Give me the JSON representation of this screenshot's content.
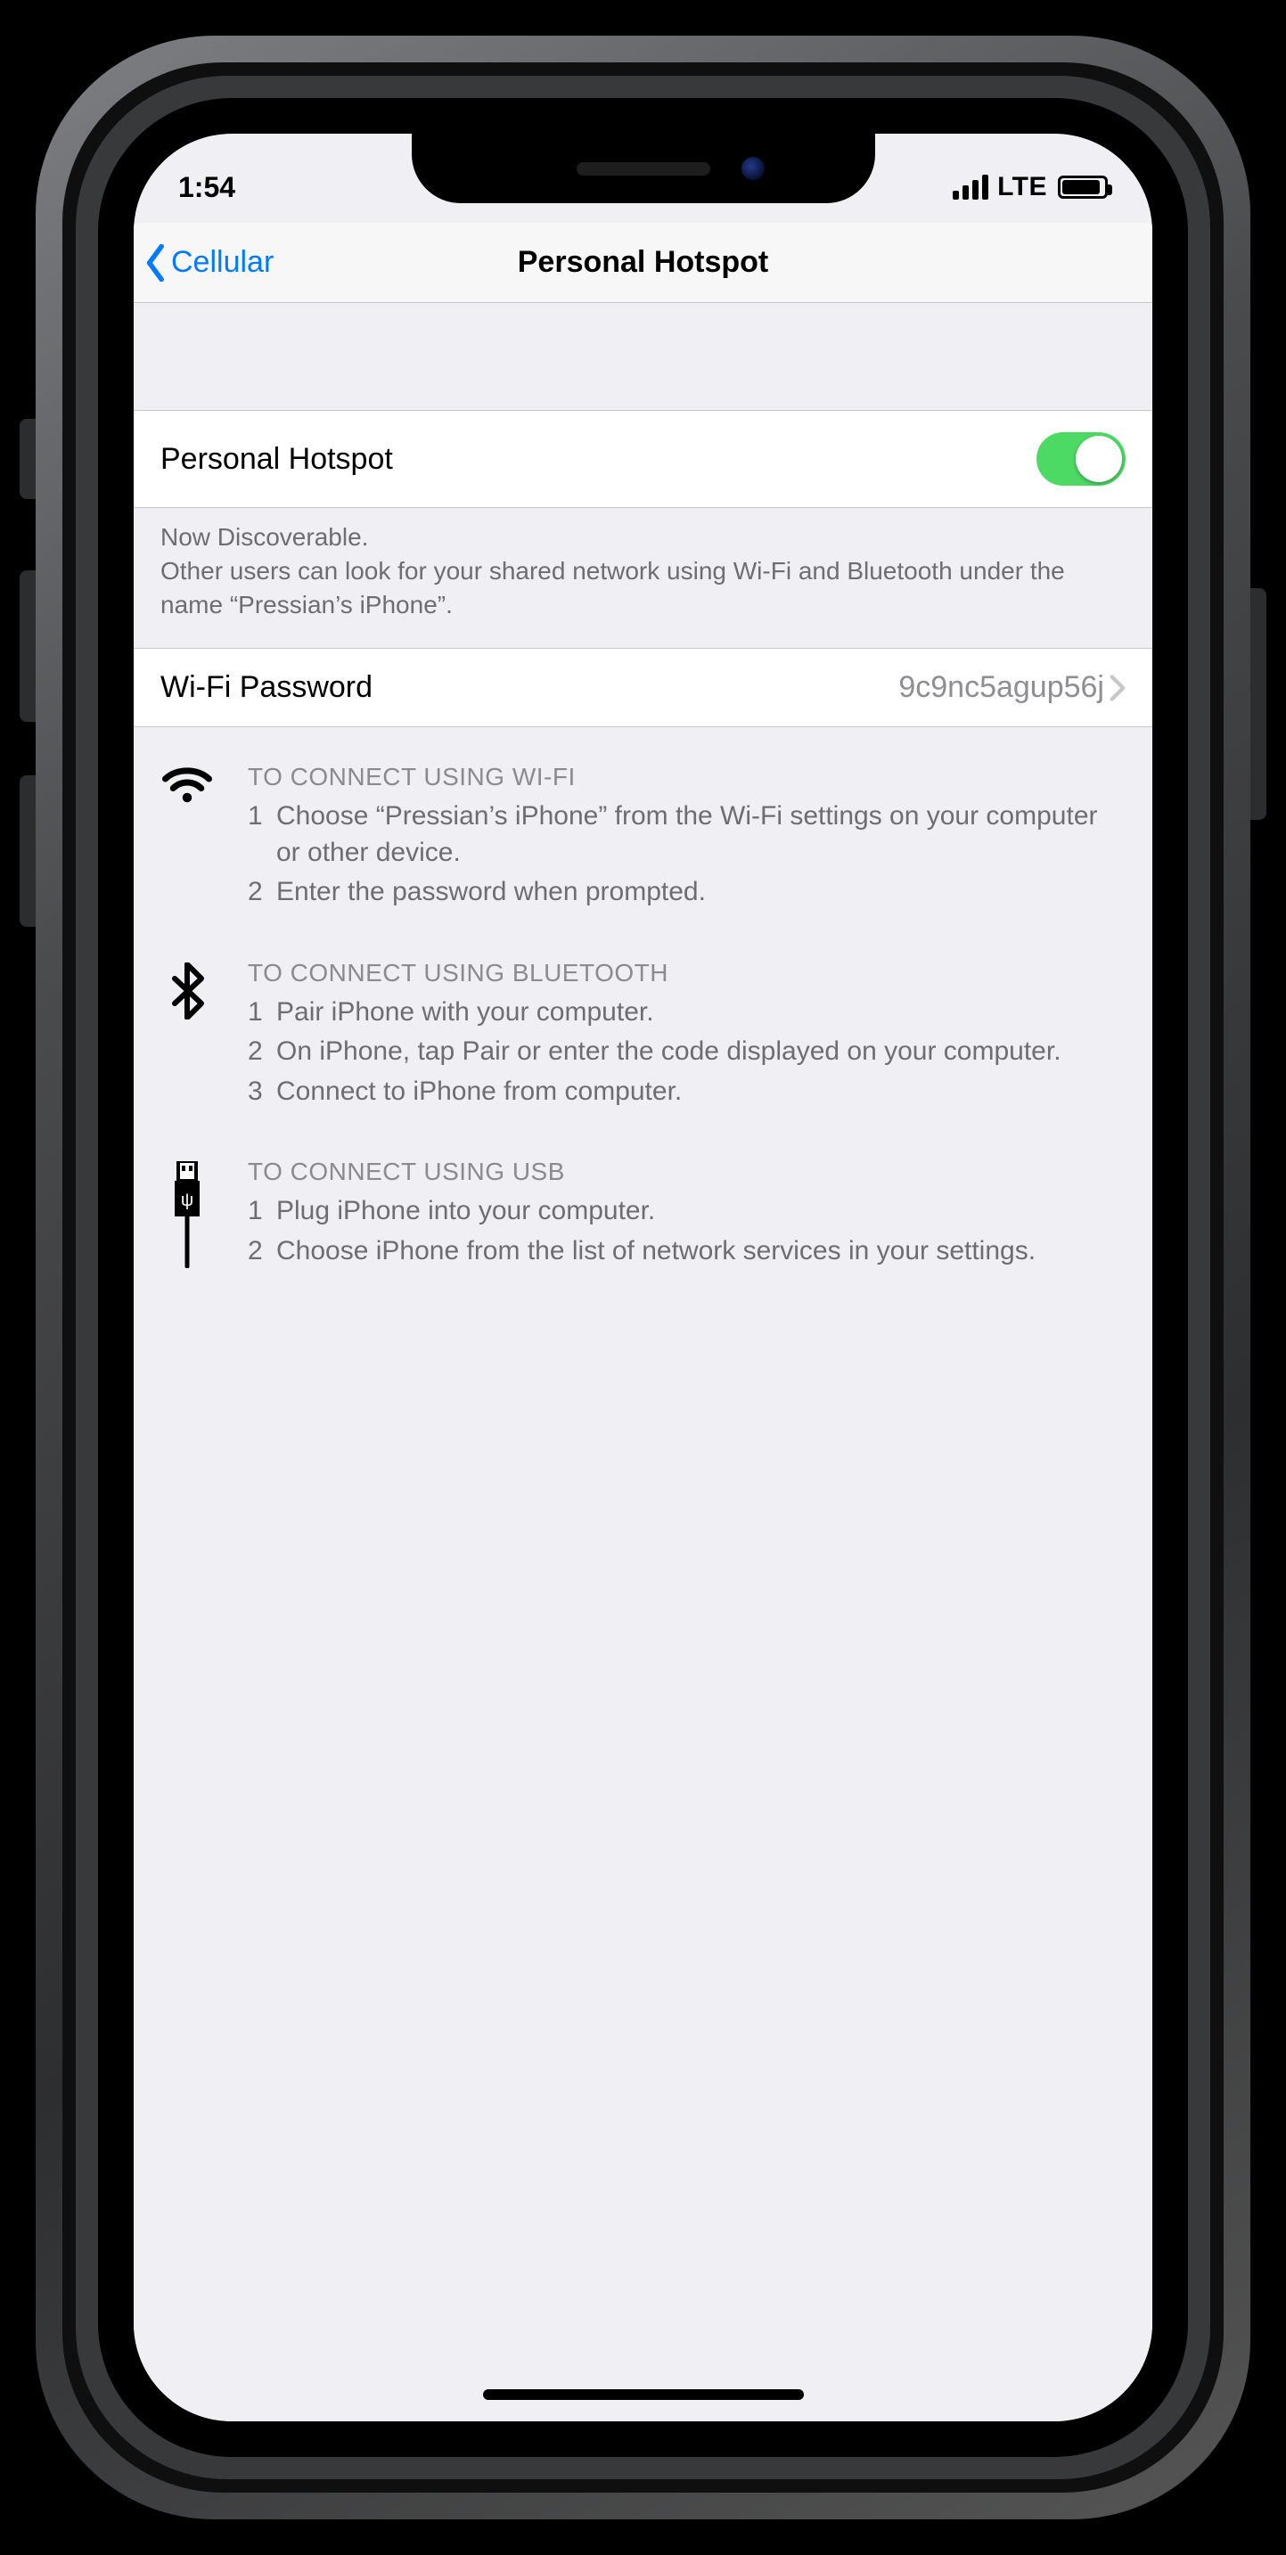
{
  "status": {
    "time": "1:54",
    "network_label": "LTE"
  },
  "nav": {
    "back_label": "Cellular",
    "title": "Personal Hotspot"
  },
  "hotspot_toggle": {
    "label": "Personal Hotspot",
    "enabled": true
  },
  "discoverable": {
    "line1": "Now Discoverable.",
    "line2": "Other users can look for your shared network using Wi-Fi and Bluetooth under the name “Pressian’s iPhone”."
  },
  "wifi_password": {
    "label": "Wi-Fi Password",
    "value": "9c9nc5agup56j"
  },
  "instructions": {
    "wifi": {
      "heading": "TO CONNECT USING WI-FI",
      "steps": [
        "Choose “Pressian’s iPhone” from the Wi-Fi settings on your computer or other device.",
        "Enter the password when prompted."
      ]
    },
    "bluetooth": {
      "heading": "TO CONNECT USING BLUETOOTH",
      "steps": [
        "Pair iPhone with your computer.",
        "On iPhone, tap Pair or enter the code displayed on your computer.",
        "Connect to iPhone from computer."
      ]
    },
    "usb": {
      "heading": "TO CONNECT USING USB",
      "steps": [
        "Plug iPhone into your computer.",
        "Choose iPhone from the list of network services in your settings."
      ]
    }
  }
}
